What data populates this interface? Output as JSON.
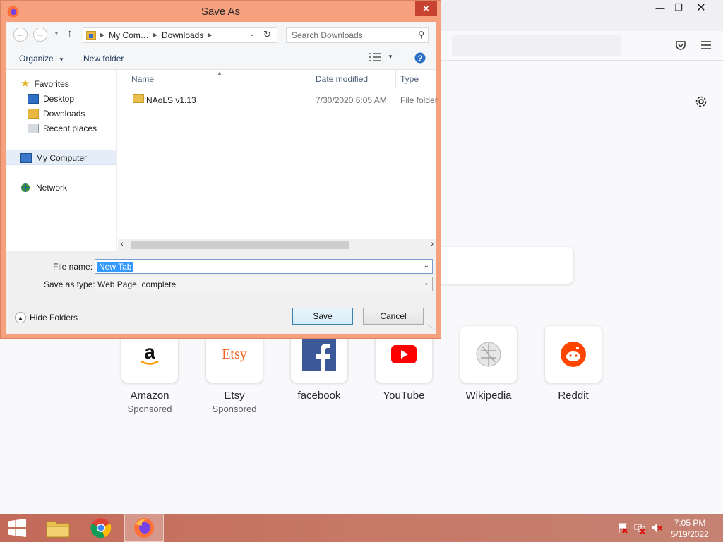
{
  "dialog": {
    "title": "Save As",
    "address": {
      "crumbs": [
        "My Com…",
        "Downloads"
      ]
    },
    "search_placeholder": "Search Downloads",
    "toolbar": {
      "organize_label": "Organize",
      "new_folder_label": "New folder"
    },
    "nav": {
      "favorites": "Favorites",
      "desktop": "Desktop",
      "downloads": "Downloads",
      "recent_places": "Recent places",
      "my_computer": "My Computer",
      "network": "Network"
    },
    "columns": {
      "name": "Name",
      "date_modified": "Date modified",
      "type": "Type"
    },
    "files": [
      {
        "name": "NAoLS v1.13",
        "date_modified": "7/30/2020 6:05 AM",
        "type": "File folder"
      }
    ],
    "file_name_label": "File name:",
    "file_name_value": "New Tab",
    "save_type_label": "Save as type:",
    "save_type_value": "Web Page, complete",
    "hide_folders_label": "Hide Folders",
    "save_label": "Save",
    "cancel_label": "Cancel"
  },
  "firefox": {
    "shortcuts": [
      {
        "title": "Amazon",
        "subtitle": "Sponsored"
      },
      {
        "title": "Etsy",
        "subtitle": "Sponsored"
      },
      {
        "title": "facebook",
        "subtitle": ""
      },
      {
        "title": "YouTube",
        "subtitle": ""
      },
      {
        "title": "Wikipedia",
        "subtitle": ""
      },
      {
        "title": "Reddit",
        "subtitle": ""
      }
    ],
    "etsy_logo_text": "Etsy",
    "amazon_logo_text": "a"
  },
  "taskbar": {
    "time": "7:05 PM",
    "date": "5/19/2022"
  },
  "colors": {
    "dialog_frame": "#f6a07e",
    "close_button": "#c7432f",
    "selection": "#3399ff",
    "taskbar": "#c77866"
  }
}
